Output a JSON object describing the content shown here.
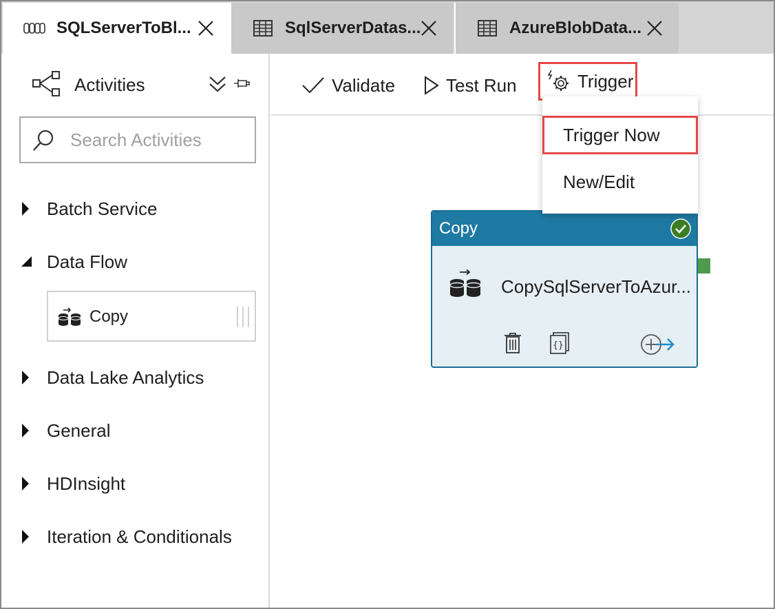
{
  "tabs": [
    {
      "label": "SQLServerToBl...",
      "icon": "pipeline-icon"
    },
    {
      "label": "SqlServerDatas...",
      "icon": "table-icon"
    },
    {
      "label": "AzureBlobData...",
      "icon": "table-icon"
    }
  ],
  "activities_panel": {
    "title": "Activities",
    "search_placeholder": "Search Activities",
    "categories": [
      {
        "label": "Batch Service",
        "expanded": false
      },
      {
        "label": "Data Flow",
        "expanded": true,
        "items": [
          {
            "label": "Copy"
          }
        ]
      },
      {
        "label": "Data Lake Analytics",
        "expanded": false
      },
      {
        "label": "General",
        "expanded": false
      },
      {
        "label": "HDInsight",
        "expanded": false
      },
      {
        "label": "Iteration & Conditionals",
        "expanded": false
      }
    ]
  },
  "toolbar": {
    "validate_label": "Validate",
    "test_run_label": "Test Run",
    "trigger_label": "Trigger"
  },
  "trigger_menu": {
    "items": [
      "Trigger Now",
      "New/Edit"
    ]
  },
  "canvas": {
    "activity": {
      "type_label": "Copy",
      "name": "CopySqlServerToAzur..."
    }
  },
  "colors": {
    "highlight": "#e34948",
    "activity_header": "#1e7aa3",
    "activity_body": "#e6eff3",
    "success": "#3b7d23"
  }
}
